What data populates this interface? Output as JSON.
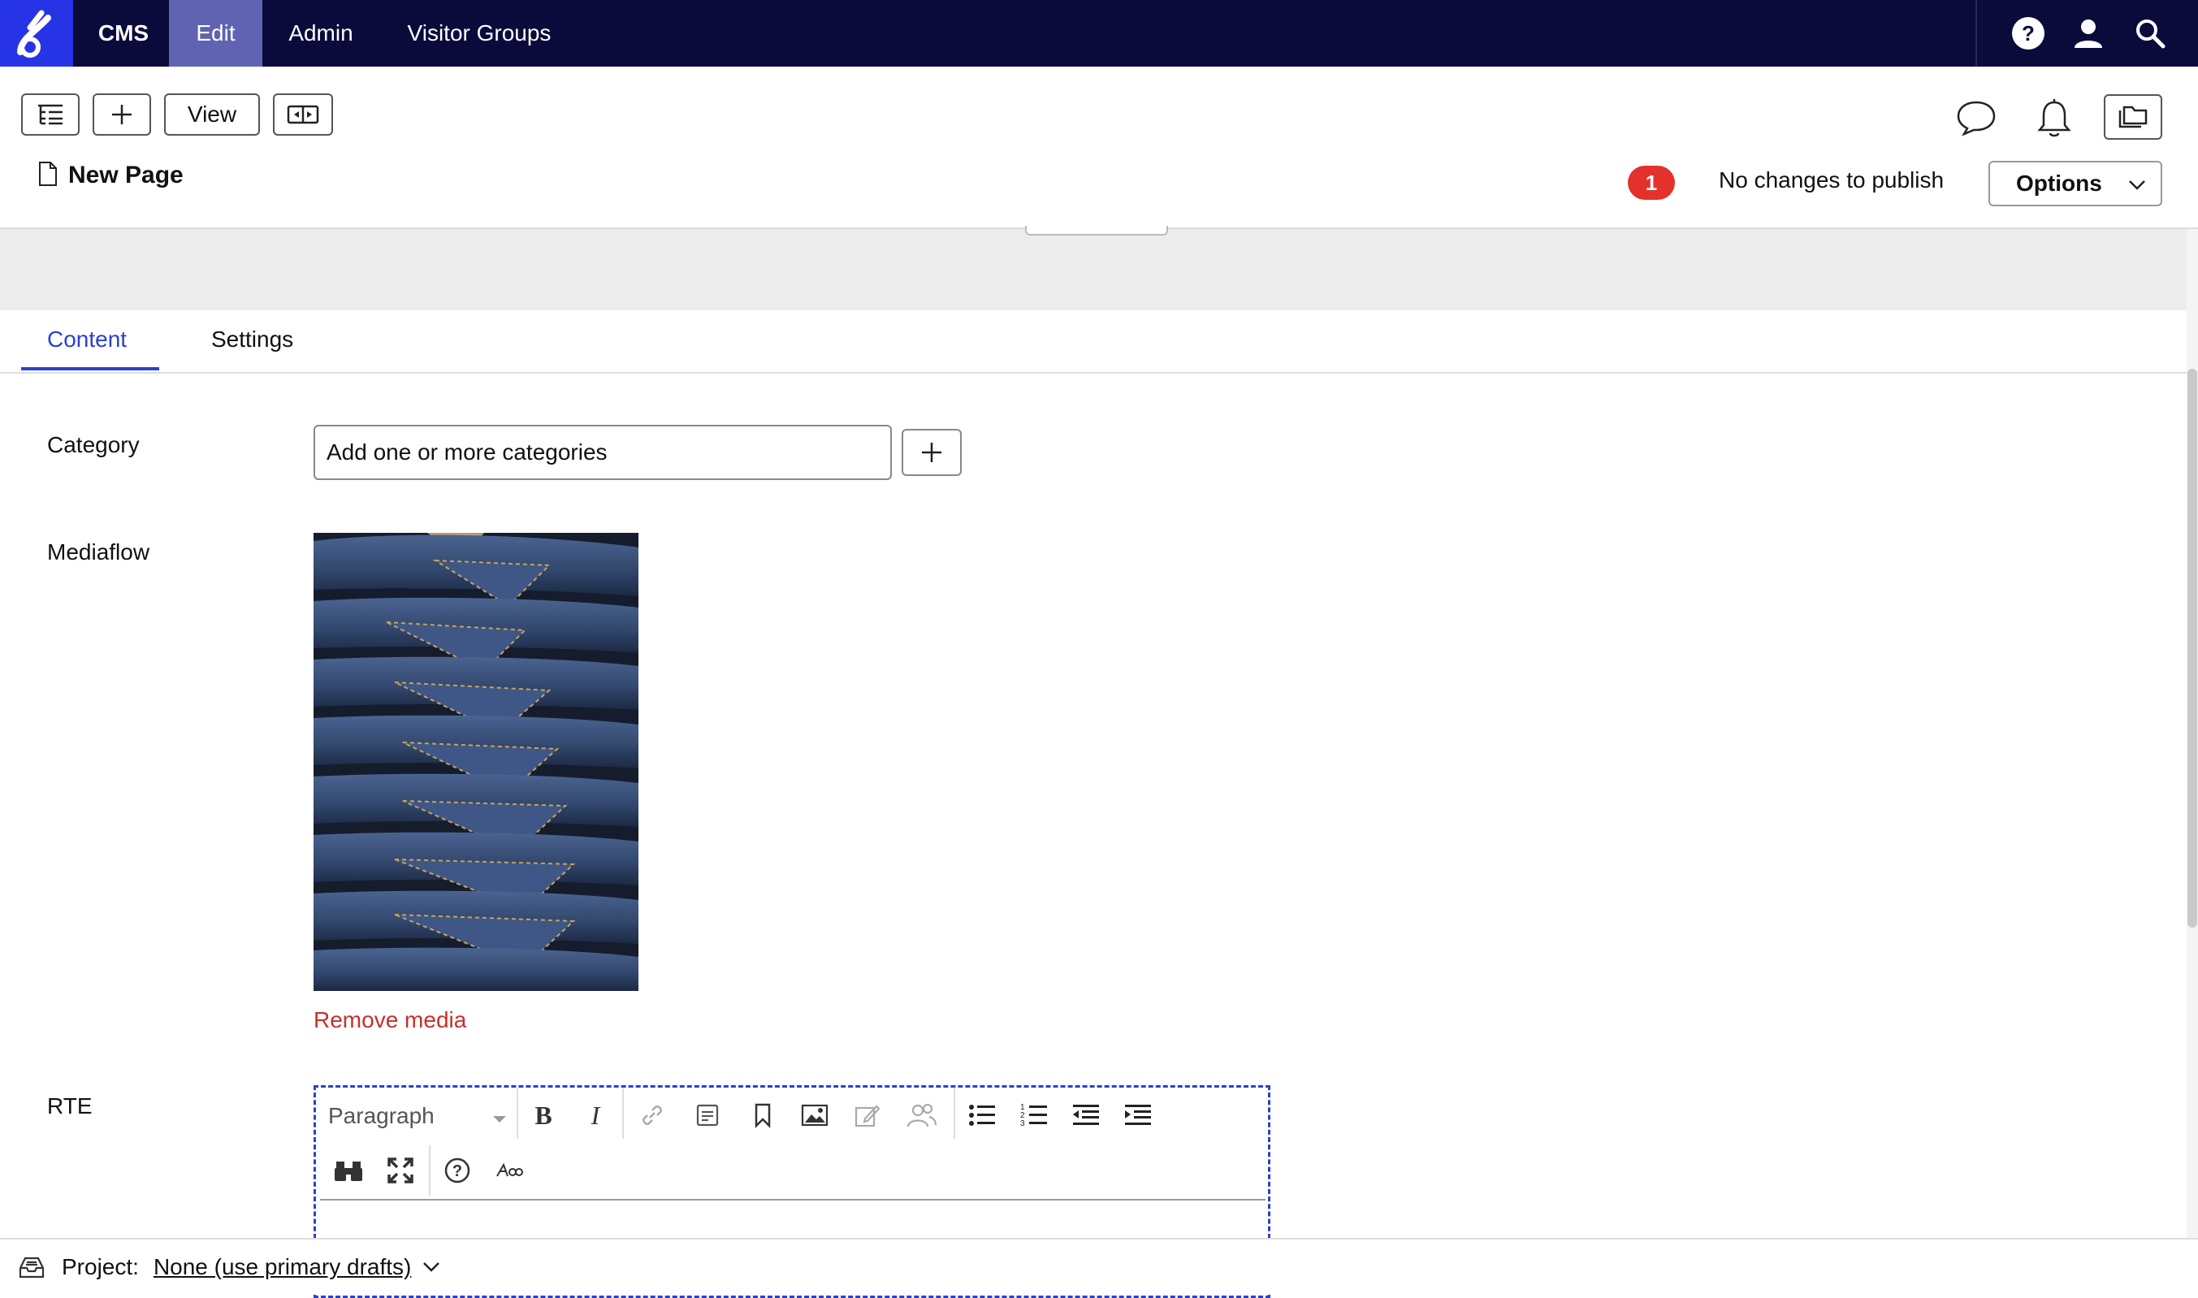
{
  "nav": {
    "items": [
      {
        "label": "CMS"
      },
      {
        "label": "Edit",
        "active": true
      },
      {
        "label": "Admin"
      },
      {
        "label": "Visitor Groups"
      }
    ],
    "icons": [
      "help-icon",
      "user-icon",
      "search-icon"
    ]
  },
  "toolbar": {
    "view_label": "View",
    "page_title": "New Page",
    "notification_count": "1",
    "publish_status": "No changes to publish",
    "options_label": "Options"
  },
  "tabs": [
    {
      "label": "Content",
      "active": true
    },
    {
      "label": "Settings"
    }
  ],
  "form": {
    "category_label": "Category",
    "category_placeholder": "Add one or more categories",
    "mediaflow_label": "Mediaflow",
    "remove_media_label": "Remove media",
    "rte_label": "RTE",
    "rte_format_value": "Paragraph"
  },
  "footer": {
    "project_label": "Project:",
    "project_value": "None (use primary drafts)"
  },
  "colors": {
    "nav_bg": "#0b0b3b",
    "nav_active": "#5f63b2",
    "logo_bg": "#2734e6",
    "accent": "#2a3fd1",
    "danger": "#c8302b"
  }
}
